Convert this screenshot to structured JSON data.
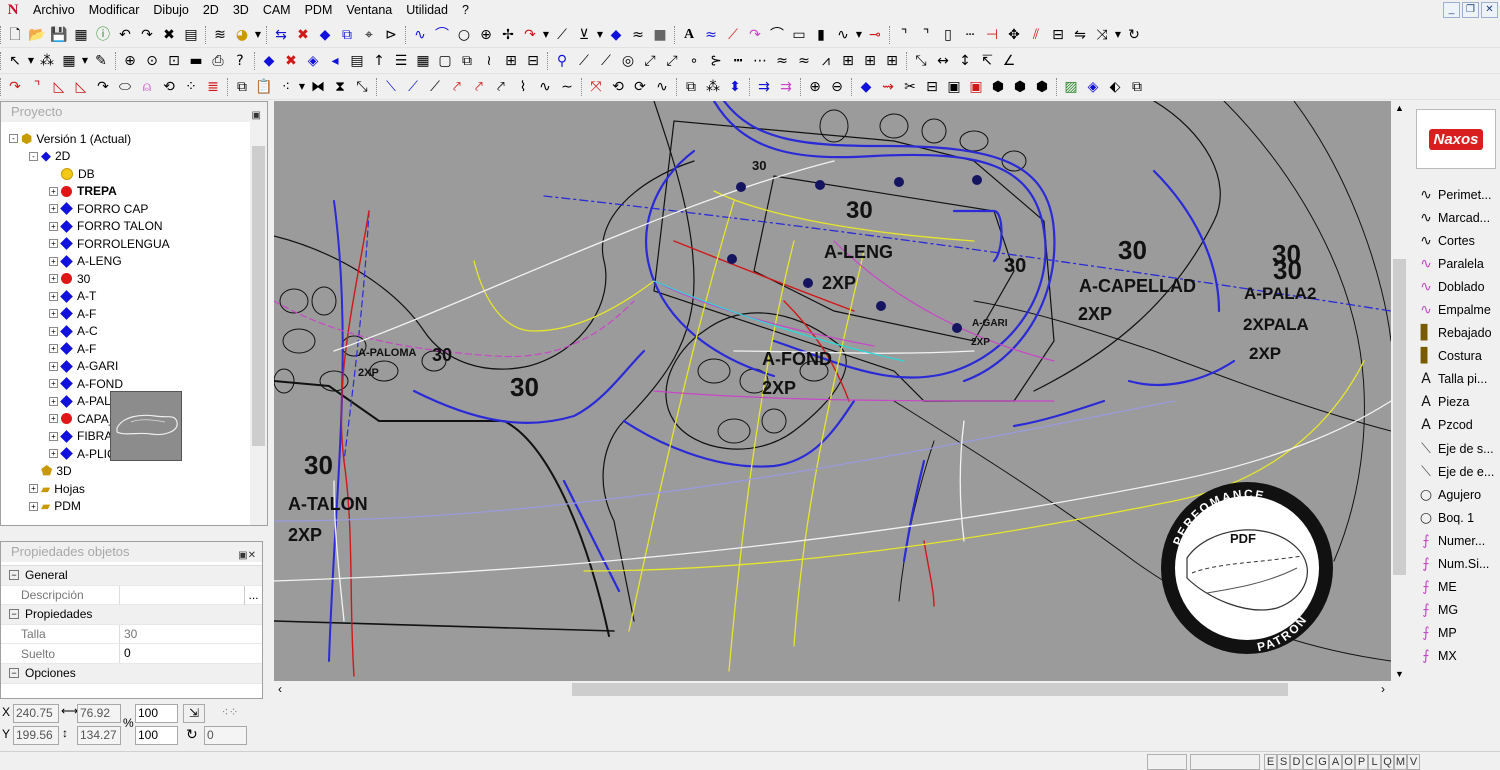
{
  "menu": {
    "items": [
      "Archivo",
      "Modificar",
      "Dibujo",
      "2D",
      "3D",
      "CAM",
      "PDM",
      "Ventana",
      "Utilidad",
      "?"
    ]
  },
  "project_panel": {
    "title": "Proyecto",
    "tree": [
      {
        "label": "Versión 1 (Actual)",
        "level": 0,
        "icon": "version-icon",
        "expand": "-"
      },
      {
        "label": "2D",
        "level": 1,
        "icon": "2d-icon",
        "expand": "-"
      },
      {
        "label": "DB",
        "level": 2,
        "icon": "yellow-dot",
        "expand": ""
      },
      {
        "label": "TREPA",
        "level": 2,
        "icon": "red-dot",
        "expand": "+",
        "bold": true
      },
      {
        "label": "FORRO CAP",
        "level": 2,
        "icon": "blue-diamond",
        "expand": "+"
      },
      {
        "label": "FORRO TALON",
        "level": 2,
        "icon": "blue-diamond",
        "expand": "+"
      },
      {
        "label": "FORROLENGUA",
        "level": 2,
        "icon": "blue-diamond",
        "expand": "+"
      },
      {
        "label": "A-LENG",
        "level": 2,
        "icon": "blue-diamond",
        "expand": "+"
      },
      {
        "label": "30",
        "level": 2,
        "icon": "red-dot",
        "expand": "+"
      },
      {
        "label": "A-T",
        "level": 2,
        "icon": "blue-diamond",
        "expand": "+"
      },
      {
        "label": "A-F",
        "level": 2,
        "icon": "blue-diamond",
        "expand": "+"
      },
      {
        "label": "A-C",
        "level": 2,
        "icon": "blue-diamond",
        "expand": "+"
      },
      {
        "label": "A-F",
        "level": 2,
        "icon": "blue-diamond",
        "expand": "+"
      },
      {
        "label": "A-GARI",
        "level": 2,
        "icon": "blue-diamond",
        "expand": "+"
      },
      {
        "label": "A-FOND",
        "level": 2,
        "icon": "blue-diamond",
        "expand": "+"
      },
      {
        "label": "A-PALA2",
        "level": 2,
        "icon": "blue-diamond",
        "expand": "+"
      },
      {
        "label": "CAPA_1",
        "level": 2,
        "icon": "red-dot",
        "expand": "+"
      },
      {
        "label": "FIBRA",
        "level": 2,
        "icon": "blue-diamond",
        "expand": "+"
      },
      {
        "label": "A-PLIC L",
        "level": 2,
        "icon": "blue-diamond",
        "expand": "+"
      },
      {
        "label": "3D",
        "level": 1,
        "icon": "3d-icon",
        "expand": ""
      },
      {
        "label": "Hojas",
        "level": 1,
        "icon": "folder-icon",
        "expand": "+"
      },
      {
        "label": "PDM",
        "level": 1,
        "icon": "folder-icon",
        "expand": "+"
      }
    ]
  },
  "properties_panel": {
    "title": "Propiedades objetos",
    "rows": [
      {
        "type": "section",
        "label": "General"
      },
      {
        "type": "field",
        "label": "Descripción",
        "value": "",
        "button": "..."
      },
      {
        "type": "section",
        "label": "Propiedades"
      },
      {
        "type": "field",
        "label": "Talla",
        "value": "30"
      },
      {
        "type": "field",
        "label": "Suelto",
        "value": "0",
        "dark": true
      },
      {
        "type": "section",
        "label": "Opciones"
      }
    ]
  },
  "coords": {
    "x_label": "X",
    "y_label": "Y",
    "x": "240.75",
    "y": "199.56",
    "width": "76.92",
    "height": "134.27",
    "percent_label": "%",
    "scale_x": "100",
    "scale_y": "100",
    "angle": "0"
  },
  "canvas": {
    "labels": [
      {
        "text": "30",
        "size": 24
      },
      {
        "text": "A-LENG",
        "size": 18
      },
      {
        "text": "2XP",
        "size": 18
      },
      {
        "text": "30",
        "size": 26
      },
      {
        "text": "A-CAPELLAD",
        "size": 18
      },
      {
        "text": "2XP",
        "size": 18
      },
      {
        "text": "30",
        "size": 26
      },
      {
        "text": "30",
        "size": 26
      },
      {
        "text": "A-PALA2",
        "size": 17
      },
      {
        "text": "2XPALA",
        "size": 17
      },
      {
        "text": "2XP",
        "size": 17
      },
      {
        "text": "30",
        "size": 20
      },
      {
        "text": "A-FOND",
        "size": 18
      },
      {
        "text": "2XP",
        "size": 18
      },
      {
        "text": "30",
        "size": 26
      },
      {
        "text": "A-PALOMA",
        "size": 11
      },
      {
        "text": "30",
        "size": 18
      },
      {
        "text": "2XP",
        "size": 11
      },
      {
        "text": "30",
        "size": 26
      },
      {
        "text": "A-TALON",
        "size": 18
      },
      {
        "text": "2XP",
        "size": 18
      },
      {
        "text": "30",
        "size": 13
      },
      {
        "text": "A-GARI",
        "size": 10
      },
      {
        "text": "2XP",
        "size": 10
      }
    ],
    "stamp": {
      "top": "PERFOMANCE",
      "center": "PDF",
      "bottom": "PATRON"
    }
  },
  "right_panel": {
    "logo": "Naxos",
    "tools": [
      {
        "label": "Perimet...",
        "icon": "curve-icon"
      },
      {
        "label": "Marcad...",
        "icon": "curve-icon"
      },
      {
        "label": "Cortes",
        "icon": "curve-icon"
      },
      {
        "label": "Paralela",
        "icon": "parallel-icon"
      },
      {
        "label": "Doblado",
        "icon": "parallel-icon"
      },
      {
        "label": "Empalme",
        "icon": "parallel-icon"
      },
      {
        "label": "Rebajado",
        "icon": "stitch-icon"
      },
      {
        "label": "Costura",
        "icon": "stitch-icon"
      },
      {
        "label": "Talla pi...",
        "icon": "text-icon"
      },
      {
        "label": "Pieza",
        "icon": "text-icon"
      },
      {
        "label": "Pzcod",
        "icon": "text-icon"
      },
      {
        "label": "Eje de s...",
        "icon": "axis-icon"
      },
      {
        "label": "Eje de e...",
        "icon": "axis-icon"
      },
      {
        "label": "Agujero",
        "icon": "circle-icon"
      },
      {
        "label": "Boq. 1",
        "icon": "circle-icon"
      },
      {
        "label": "Numer...",
        "icon": "pen-icon"
      },
      {
        "label": "Num.Si...",
        "icon": "pen-icon"
      },
      {
        "label": "ME",
        "icon": "pen-icon"
      },
      {
        "label": "MG",
        "icon": "pen-icon"
      },
      {
        "label": "MP",
        "icon": "pen-icon"
      },
      {
        "label": "MX",
        "icon": "pen-icon"
      }
    ]
  },
  "status": {
    "letters": [
      "E",
      "S",
      "D",
      "C",
      "G",
      "A",
      "O",
      "P",
      "L",
      "Q",
      "M",
      "V"
    ]
  },
  "colors": {
    "canvas_bg": "#9b9b9b",
    "blue": "#2a2ad8",
    "red": "#d01818",
    "yellow": "#e6e62a",
    "magenta": "#c846c8",
    "navy_dot": "#141460"
  }
}
